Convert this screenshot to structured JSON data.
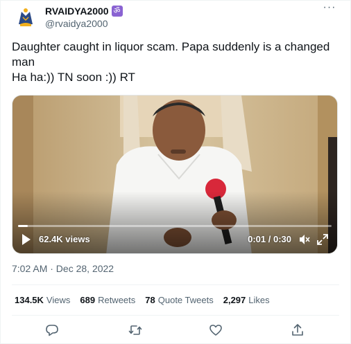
{
  "author": {
    "display_name": "RVAIDYA2000",
    "badge_glyph": "ॐ",
    "handle": "@rvaidya2000",
    "avatar_icon": "emblem-avatar-icon"
  },
  "menu": {
    "more_label": "···"
  },
  "tweet": {
    "text": "Daughter caught in liquor scam. Papa suddenly is a changed man\nHa ha:)) TN soon :)) RT"
  },
  "video": {
    "views": "62.4K views",
    "timecode": "0:01 / 0:30",
    "progress_fraction": 0.03,
    "play_icon": "play-icon",
    "mute_icon": "mute-icon",
    "fullscreen_icon": "fullscreen-icon"
  },
  "timestamp": "7:02 AM · Dec 28, 2022",
  "stats": {
    "views_count": "134.5K",
    "views_label": "Views",
    "retweets_count": "689",
    "retweets_label": "Retweets",
    "quotes_count": "78",
    "quotes_label": "Quote Tweets",
    "likes_count": "2,297",
    "likes_label": "Likes"
  },
  "actions": {
    "reply_icon": "reply-icon",
    "retweet_icon": "retweet-icon",
    "like_icon": "like-icon",
    "share_icon": "share-icon"
  },
  "colors": {
    "text": "#0f1419",
    "secondary": "#536471",
    "divider": "#eff3f4",
    "badge": "#8a63d2"
  }
}
